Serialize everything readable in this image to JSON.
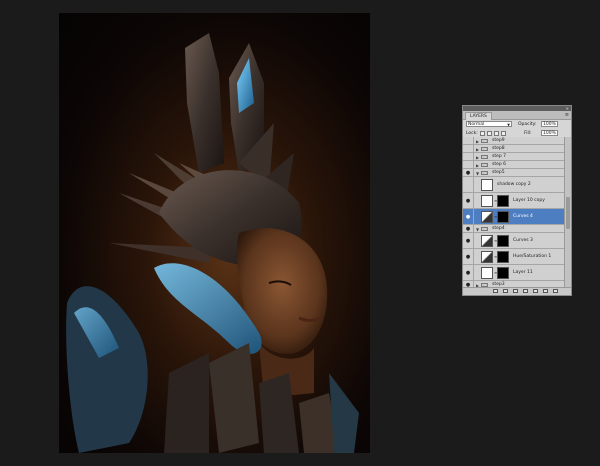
{
  "panel": {
    "tab_label": "LAYERS",
    "close_glyph": "×",
    "menu_glyph": "≡",
    "blend_mode": "Normal",
    "opacity_label": "Opacity:",
    "opacity_value": "100%",
    "lock_label": "Lock:",
    "fill_label": "Fill:",
    "fill_value": "100%",
    "layers": [
      {
        "name": "step9",
        "type": "group",
        "visible": false,
        "expanded": false
      },
      {
        "name": "step8",
        "type": "group",
        "visible": false,
        "expanded": false
      },
      {
        "name": "step 7",
        "type": "group",
        "visible": false,
        "expanded": false
      },
      {
        "name": "step 6",
        "type": "group",
        "visible": false,
        "expanded": false
      },
      {
        "name": "step5",
        "type": "group",
        "visible": true,
        "expanded": true
      },
      {
        "name": "shadow copy 2",
        "type": "layer",
        "visible": false
      },
      {
        "name": "Layer 10 copy",
        "type": "layer",
        "visible": true,
        "mask": true
      },
      {
        "name": "Curves 4",
        "type": "adjustment",
        "visible": true,
        "mask": true,
        "selected": true
      },
      {
        "name": "step4",
        "type": "group",
        "visible": true,
        "expanded": true
      },
      {
        "name": "Curves 3",
        "type": "adjustment",
        "visible": true,
        "mask": true
      },
      {
        "name": "Hue/Saturation 1",
        "type": "adjustment",
        "visible": true,
        "mask": true
      },
      {
        "name": "Layer 11",
        "type": "layer",
        "visible": true,
        "mask": true
      },
      {
        "name": "step3",
        "type": "group",
        "visible": true,
        "expanded": false
      }
    ]
  },
  "colors": {
    "selection": "#4d7ec2",
    "accent_blue": "#3aa6e8",
    "panel_bg": "#d6d6d6",
    "app_bg": "#1b1b1b"
  },
  "icons": {
    "eye": "eye-icon",
    "folder": "folder-icon",
    "link": "link-icon",
    "footer": [
      "link-layers-icon",
      "fx-icon",
      "add-mask-icon",
      "adjustment-icon",
      "new-group-icon",
      "new-layer-icon",
      "trash-icon"
    ]
  }
}
